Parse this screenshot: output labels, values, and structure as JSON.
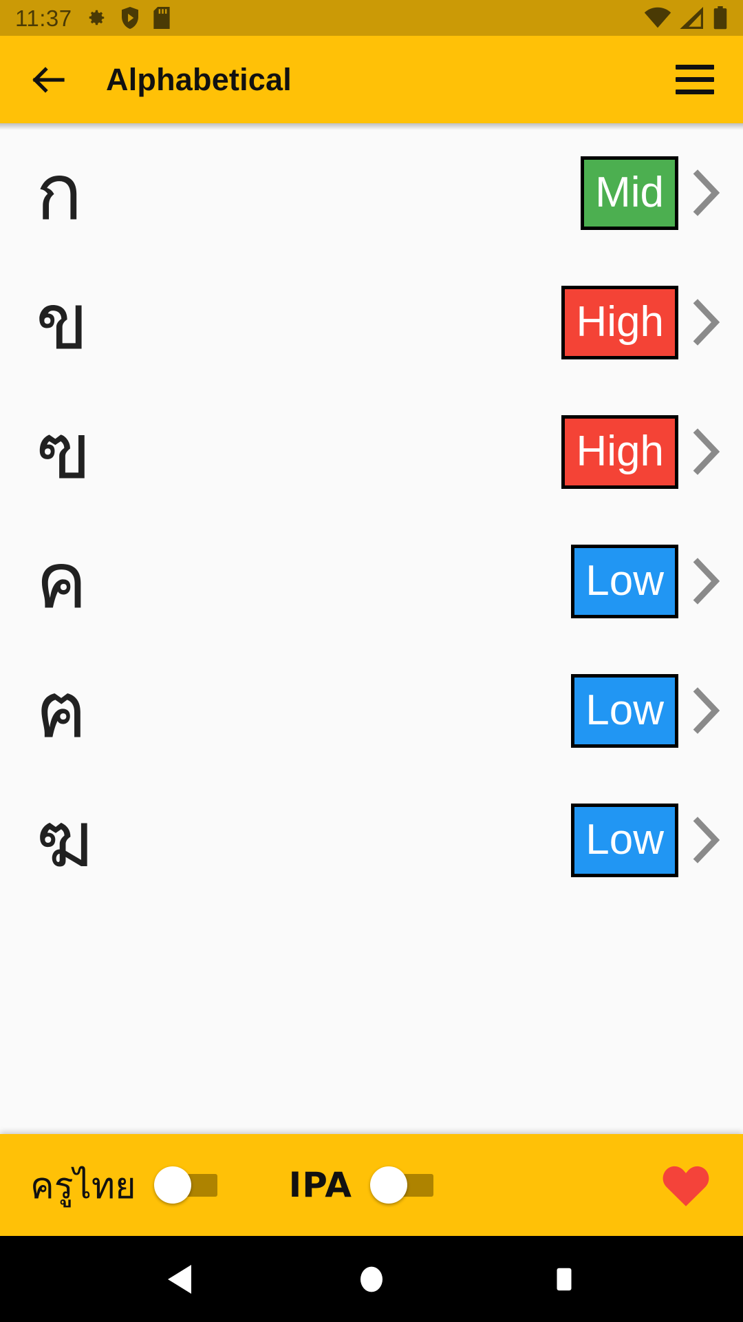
{
  "status_bar": {
    "clock": "11:37",
    "left_icons": [
      "gear-icon",
      "shield-play-icon",
      "sd-card-icon"
    ],
    "right_icons": [
      "wifi-icon",
      "cellular-signal-icon",
      "battery-icon"
    ],
    "background": "#cb9a06",
    "foreground": "#4a3a05"
  },
  "app_bar": {
    "back_icon": "arrow-left-icon",
    "title": "Alphabetical",
    "menu_icon": "hamburger-menu-icon",
    "background": "#ffc107"
  },
  "list": {
    "rows": [
      {
        "letter": "ก",
        "class_label": "Mid",
        "class_key": "mid",
        "color": "#4caf50",
        "chevron": "chevron-right-icon"
      },
      {
        "letter": "ข",
        "class_label": "High",
        "class_key": "high",
        "color": "#f44336",
        "chevron": "chevron-right-icon"
      },
      {
        "letter": "ฃ",
        "class_label": "High",
        "class_key": "high",
        "color": "#f44336",
        "chevron": "chevron-right-icon"
      },
      {
        "letter": "ค",
        "class_label": "Low",
        "class_key": "low",
        "color": "#2196f3",
        "chevron": "chevron-right-icon"
      },
      {
        "letter": "ฅ",
        "class_label": "Low",
        "class_key": "low",
        "color": "#2196f3",
        "chevron": "chevron-right-icon"
      },
      {
        "letter": "ฆ",
        "class_label": "Low",
        "class_key": "low",
        "color": "#2196f3",
        "chevron": "chevron-right-icon"
      }
    ],
    "background": "#fafafa"
  },
  "bottom_bar": {
    "thai_teacher_label": "ครูไทย",
    "thai_teacher_toggle": "off",
    "ipa_label": "IPA",
    "ipa_toggle": "off",
    "favorite_icon": "heart-icon",
    "favorite_color": "#f44336",
    "background": "#ffc107"
  },
  "nav_bar": {
    "back_icon": "nav-back-triangle-icon",
    "home_icon": "nav-home-circle-icon",
    "recents_icon": "nav-recents-square-icon",
    "background": "#000000"
  }
}
